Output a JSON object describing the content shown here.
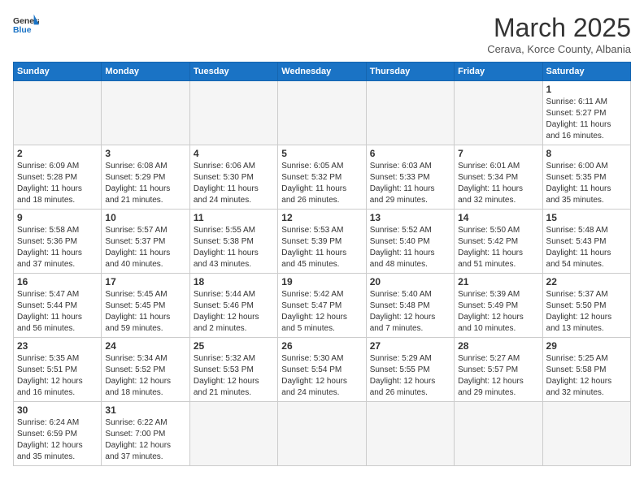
{
  "header": {
    "logo_general": "General",
    "logo_blue": "Blue",
    "title": "March 2025",
    "subtitle": "Cerava, Korce County, Albania"
  },
  "weekdays": [
    "Sunday",
    "Monday",
    "Tuesday",
    "Wednesday",
    "Thursday",
    "Friday",
    "Saturday"
  ],
  "weeks": [
    [
      {
        "day": "",
        "info": ""
      },
      {
        "day": "",
        "info": ""
      },
      {
        "day": "",
        "info": ""
      },
      {
        "day": "",
        "info": ""
      },
      {
        "day": "",
        "info": ""
      },
      {
        "day": "",
        "info": ""
      },
      {
        "day": "1",
        "info": "Sunrise: 6:11 AM\nSunset: 5:27 PM\nDaylight: 11 hours\nand 16 minutes."
      }
    ],
    [
      {
        "day": "2",
        "info": "Sunrise: 6:09 AM\nSunset: 5:28 PM\nDaylight: 11 hours\nand 18 minutes."
      },
      {
        "day": "3",
        "info": "Sunrise: 6:08 AM\nSunset: 5:29 PM\nDaylight: 11 hours\nand 21 minutes."
      },
      {
        "day": "4",
        "info": "Sunrise: 6:06 AM\nSunset: 5:30 PM\nDaylight: 11 hours\nand 24 minutes."
      },
      {
        "day": "5",
        "info": "Sunrise: 6:05 AM\nSunset: 5:32 PM\nDaylight: 11 hours\nand 26 minutes."
      },
      {
        "day": "6",
        "info": "Sunrise: 6:03 AM\nSunset: 5:33 PM\nDaylight: 11 hours\nand 29 minutes."
      },
      {
        "day": "7",
        "info": "Sunrise: 6:01 AM\nSunset: 5:34 PM\nDaylight: 11 hours\nand 32 minutes."
      },
      {
        "day": "8",
        "info": "Sunrise: 6:00 AM\nSunset: 5:35 PM\nDaylight: 11 hours\nand 35 minutes."
      }
    ],
    [
      {
        "day": "9",
        "info": "Sunrise: 5:58 AM\nSunset: 5:36 PM\nDaylight: 11 hours\nand 37 minutes."
      },
      {
        "day": "10",
        "info": "Sunrise: 5:57 AM\nSunset: 5:37 PM\nDaylight: 11 hours\nand 40 minutes."
      },
      {
        "day": "11",
        "info": "Sunrise: 5:55 AM\nSunset: 5:38 PM\nDaylight: 11 hours\nand 43 minutes."
      },
      {
        "day": "12",
        "info": "Sunrise: 5:53 AM\nSunset: 5:39 PM\nDaylight: 11 hours\nand 45 minutes."
      },
      {
        "day": "13",
        "info": "Sunrise: 5:52 AM\nSunset: 5:40 PM\nDaylight: 11 hours\nand 48 minutes."
      },
      {
        "day": "14",
        "info": "Sunrise: 5:50 AM\nSunset: 5:42 PM\nDaylight: 11 hours\nand 51 minutes."
      },
      {
        "day": "15",
        "info": "Sunrise: 5:48 AM\nSunset: 5:43 PM\nDaylight: 11 hours\nand 54 minutes."
      }
    ],
    [
      {
        "day": "16",
        "info": "Sunrise: 5:47 AM\nSunset: 5:44 PM\nDaylight: 11 hours\nand 56 minutes."
      },
      {
        "day": "17",
        "info": "Sunrise: 5:45 AM\nSunset: 5:45 PM\nDaylight: 11 hours\nand 59 minutes."
      },
      {
        "day": "18",
        "info": "Sunrise: 5:44 AM\nSunset: 5:46 PM\nDaylight: 12 hours\nand 2 minutes."
      },
      {
        "day": "19",
        "info": "Sunrise: 5:42 AM\nSunset: 5:47 PM\nDaylight: 12 hours\nand 5 minutes."
      },
      {
        "day": "20",
        "info": "Sunrise: 5:40 AM\nSunset: 5:48 PM\nDaylight: 12 hours\nand 7 minutes."
      },
      {
        "day": "21",
        "info": "Sunrise: 5:39 AM\nSunset: 5:49 PM\nDaylight: 12 hours\nand 10 minutes."
      },
      {
        "day": "22",
        "info": "Sunrise: 5:37 AM\nSunset: 5:50 PM\nDaylight: 12 hours\nand 13 minutes."
      }
    ],
    [
      {
        "day": "23",
        "info": "Sunrise: 5:35 AM\nSunset: 5:51 PM\nDaylight: 12 hours\nand 16 minutes."
      },
      {
        "day": "24",
        "info": "Sunrise: 5:34 AM\nSunset: 5:52 PM\nDaylight: 12 hours\nand 18 minutes."
      },
      {
        "day": "25",
        "info": "Sunrise: 5:32 AM\nSunset: 5:53 PM\nDaylight: 12 hours\nand 21 minutes."
      },
      {
        "day": "26",
        "info": "Sunrise: 5:30 AM\nSunset: 5:54 PM\nDaylight: 12 hours\nand 24 minutes."
      },
      {
        "day": "27",
        "info": "Sunrise: 5:29 AM\nSunset: 5:55 PM\nDaylight: 12 hours\nand 26 minutes."
      },
      {
        "day": "28",
        "info": "Sunrise: 5:27 AM\nSunset: 5:57 PM\nDaylight: 12 hours\nand 29 minutes."
      },
      {
        "day": "29",
        "info": "Sunrise: 5:25 AM\nSunset: 5:58 PM\nDaylight: 12 hours\nand 32 minutes."
      }
    ],
    [
      {
        "day": "30",
        "info": "Sunrise: 6:24 AM\nSunset: 6:59 PM\nDaylight: 12 hours\nand 35 minutes."
      },
      {
        "day": "31",
        "info": "Sunrise: 6:22 AM\nSunset: 7:00 PM\nDaylight: 12 hours\nand 37 minutes."
      },
      {
        "day": "",
        "info": ""
      },
      {
        "day": "",
        "info": ""
      },
      {
        "day": "",
        "info": ""
      },
      {
        "day": "",
        "info": ""
      },
      {
        "day": "",
        "info": ""
      }
    ]
  ]
}
